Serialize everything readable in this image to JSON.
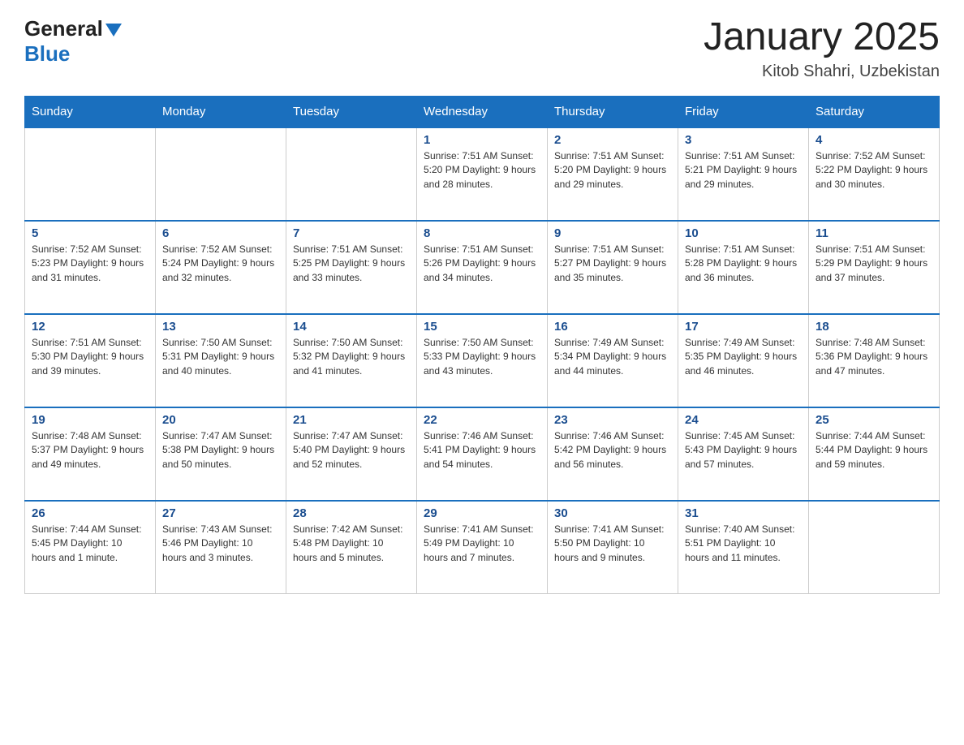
{
  "header": {
    "logo_general": "General",
    "logo_blue": "Blue",
    "title": "January 2025",
    "subtitle": "Kitob Shahri, Uzbekistan"
  },
  "days_of_week": [
    "Sunday",
    "Monday",
    "Tuesday",
    "Wednesday",
    "Thursday",
    "Friday",
    "Saturday"
  ],
  "weeks": [
    [
      {
        "day": "",
        "info": ""
      },
      {
        "day": "",
        "info": ""
      },
      {
        "day": "",
        "info": ""
      },
      {
        "day": "1",
        "info": "Sunrise: 7:51 AM\nSunset: 5:20 PM\nDaylight: 9 hours and 28 minutes."
      },
      {
        "day": "2",
        "info": "Sunrise: 7:51 AM\nSunset: 5:20 PM\nDaylight: 9 hours and 29 minutes."
      },
      {
        "day": "3",
        "info": "Sunrise: 7:51 AM\nSunset: 5:21 PM\nDaylight: 9 hours and 29 minutes."
      },
      {
        "day": "4",
        "info": "Sunrise: 7:52 AM\nSunset: 5:22 PM\nDaylight: 9 hours and 30 minutes."
      }
    ],
    [
      {
        "day": "5",
        "info": "Sunrise: 7:52 AM\nSunset: 5:23 PM\nDaylight: 9 hours and 31 minutes."
      },
      {
        "day": "6",
        "info": "Sunrise: 7:52 AM\nSunset: 5:24 PM\nDaylight: 9 hours and 32 minutes."
      },
      {
        "day": "7",
        "info": "Sunrise: 7:51 AM\nSunset: 5:25 PM\nDaylight: 9 hours and 33 minutes."
      },
      {
        "day": "8",
        "info": "Sunrise: 7:51 AM\nSunset: 5:26 PM\nDaylight: 9 hours and 34 minutes."
      },
      {
        "day": "9",
        "info": "Sunrise: 7:51 AM\nSunset: 5:27 PM\nDaylight: 9 hours and 35 minutes."
      },
      {
        "day": "10",
        "info": "Sunrise: 7:51 AM\nSunset: 5:28 PM\nDaylight: 9 hours and 36 minutes."
      },
      {
        "day": "11",
        "info": "Sunrise: 7:51 AM\nSunset: 5:29 PM\nDaylight: 9 hours and 37 minutes."
      }
    ],
    [
      {
        "day": "12",
        "info": "Sunrise: 7:51 AM\nSunset: 5:30 PM\nDaylight: 9 hours and 39 minutes."
      },
      {
        "day": "13",
        "info": "Sunrise: 7:50 AM\nSunset: 5:31 PM\nDaylight: 9 hours and 40 minutes."
      },
      {
        "day": "14",
        "info": "Sunrise: 7:50 AM\nSunset: 5:32 PM\nDaylight: 9 hours and 41 minutes."
      },
      {
        "day": "15",
        "info": "Sunrise: 7:50 AM\nSunset: 5:33 PM\nDaylight: 9 hours and 43 minutes."
      },
      {
        "day": "16",
        "info": "Sunrise: 7:49 AM\nSunset: 5:34 PM\nDaylight: 9 hours and 44 minutes."
      },
      {
        "day": "17",
        "info": "Sunrise: 7:49 AM\nSunset: 5:35 PM\nDaylight: 9 hours and 46 minutes."
      },
      {
        "day": "18",
        "info": "Sunrise: 7:48 AM\nSunset: 5:36 PM\nDaylight: 9 hours and 47 minutes."
      }
    ],
    [
      {
        "day": "19",
        "info": "Sunrise: 7:48 AM\nSunset: 5:37 PM\nDaylight: 9 hours and 49 minutes."
      },
      {
        "day": "20",
        "info": "Sunrise: 7:47 AM\nSunset: 5:38 PM\nDaylight: 9 hours and 50 minutes."
      },
      {
        "day": "21",
        "info": "Sunrise: 7:47 AM\nSunset: 5:40 PM\nDaylight: 9 hours and 52 minutes."
      },
      {
        "day": "22",
        "info": "Sunrise: 7:46 AM\nSunset: 5:41 PM\nDaylight: 9 hours and 54 minutes."
      },
      {
        "day": "23",
        "info": "Sunrise: 7:46 AM\nSunset: 5:42 PM\nDaylight: 9 hours and 56 minutes."
      },
      {
        "day": "24",
        "info": "Sunrise: 7:45 AM\nSunset: 5:43 PM\nDaylight: 9 hours and 57 minutes."
      },
      {
        "day": "25",
        "info": "Sunrise: 7:44 AM\nSunset: 5:44 PM\nDaylight: 9 hours and 59 minutes."
      }
    ],
    [
      {
        "day": "26",
        "info": "Sunrise: 7:44 AM\nSunset: 5:45 PM\nDaylight: 10 hours and 1 minute."
      },
      {
        "day": "27",
        "info": "Sunrise: 7:43 AM\nSunset: 5:46 PM\nDaylight: 10 hours and 3 minutes."
      },
      {
        "day": "28",
        "info": "Sunrise: 7:42 AM\nSunset: 5:48 PM\nDaylight: 10 hours and 5 minutes."
      },
      {
        "day": "29",
        "info": "Sunrise: 7:41 AM\nSunset: 5:49 PM\nDaylight: 10 hours and 7 minutes."
      },
      {
        "day": "30",
        "info": "Sunrise: 7:41 AM\nSunset: 5:50 PM\nDaylight: 10 hours and 9 minutes."
      },
      {
        "day": "31",
        "info": "Sunrise: 7:40 AM\nSunset: 5:51 PM\nDaylight: 10 hours and 11 minutes."
      },
      {
        "day": "",
        "info": ""
      }
    ]
  ]
}
